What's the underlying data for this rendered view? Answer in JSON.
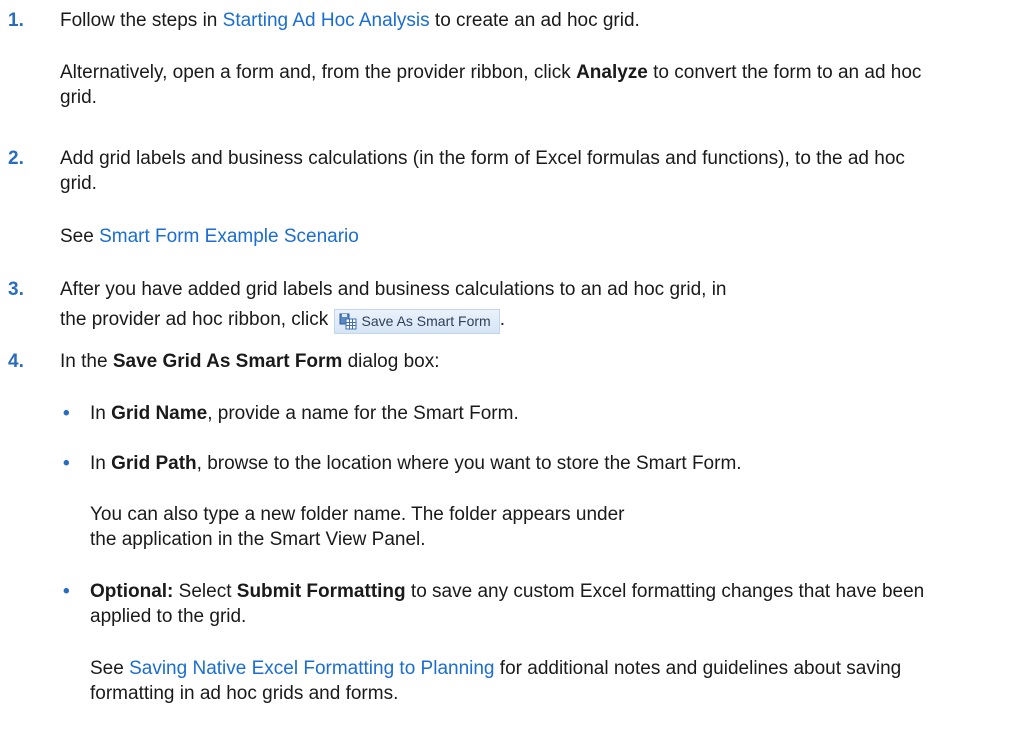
{
  "steps": [
    {
      "number": "1.",
      "text_before": "Follow the steps in ",
      "link": "Starting Ad Hoc Analysis",
      "text_after": " to create an ad hoc grid.",
      "para2_a": "Alternatively, open a form and, from the provider ribbon, click ",
      "para2_bold": "Analyze",
      "para2_b": " to convert the form to an ad hoc grid."
    },
    {
      "number": "2.",
      "text": "Add grid labels and business calculations (in the form of Excel formulas and functions), to the ad hoc grid.",
      "see_prefix": "See ",
      "see_link": "Smart Form Example Scenario"
    },
    {
      "number": "3.",
      "text_line1": "After you have added grid labels and business calculations to an ad hoc grid, in",
      "text_line2": "the provider ad hoc ribbon, click ",
      "button_label": "Save As Smart Form",
      "text_end": "."
    },
    {
      "number": "4.",
      "text_before": "In the ",
      "bold": "Save Grid As Smart Form",
      "text_after": " dialog box:",
      "bullets": [
        {
          "marker": "•",
          "text_before": "In ",
          "bold": "Grid Name",
          "text_after": ", provide a name for the Smart Form."
        },
        {
          "marker": "•",
          "text_before": "In ",
          "bold": "Grid Path",
          "text_after": ", browse to the location where you want to store the Smart Form.",
          "note": "You can also type a new folder name. The folder appears under the application in the Smart View Panel."
        },
        {
          "marker": "•",
          "bold1": "Optional:",
          "text_mid": " Select ",
          "bold2": "Submit Formatting",
          "text_after": " to save any custom Excel formatting changes that have been applied to the grid.",
          "see_prefix": "See ",
          "see_link": "Saving Native Excel Formatting to Planning",
          "see_after": " for additional notes and guidelines about saving formatting in ad hoc grids and forms."
        }
      ]
    }
  ],
  "colors": {
    "link": "#1a6dd2",
    "number": "#2a6cbf",
    "text": "#1a1a1a"
  },
  "icons": {
    "ribbon_button": "smart-form-grid-icon"
  }
}
